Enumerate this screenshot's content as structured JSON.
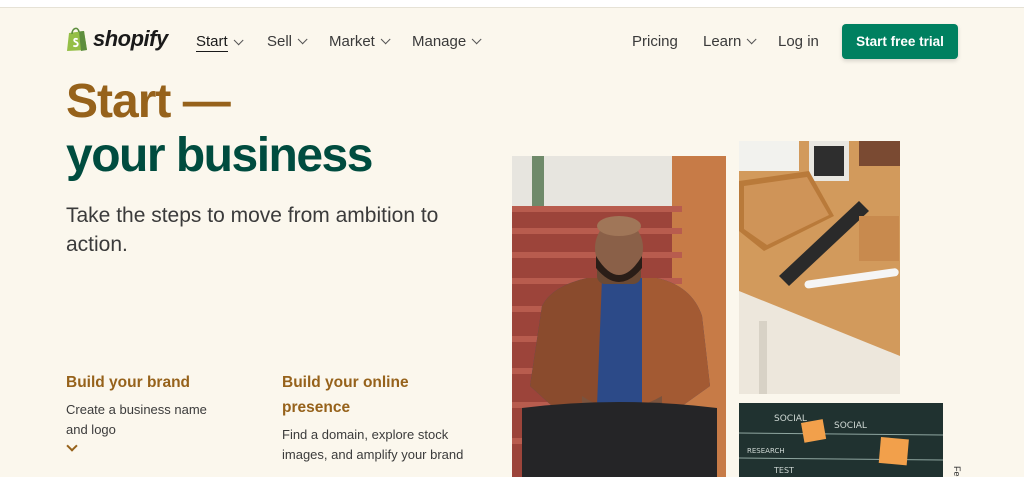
{
  "brand": {
    "name": "shopify",
    "color": "#008060",
    "bag_color": "#95bf47"
  },
  "nav": {
    "start": "Start",
    "sell": "Sell",
    "market": "Market",
    "manage": "Manage",
    "pricing": "Pricing",
    "learn": "Learn",
    "login": "Log in",
    "cta": "Start free trial"
  },
  "hero": {
    "title_line1": "Start —",
    "title_line2": "your business",
    "subtitle": "Take the steps to move from ambition to action."
  },
  "features": [
    {
      "title": "Build your brand",
      "desc": "Create a business name and logo"
    },
    {
      "title": "Build your online presence",
      "desc": "Find a domain, explore stock images, and amplify your brand"
    }
  ],
  "side_tab": "Fe",
  "colors": {
    "background": "#fbf7ed",
    "gold": "#96621b",
    "dark_green": "#004c3f",
    "button": "#008060"
  }
}
